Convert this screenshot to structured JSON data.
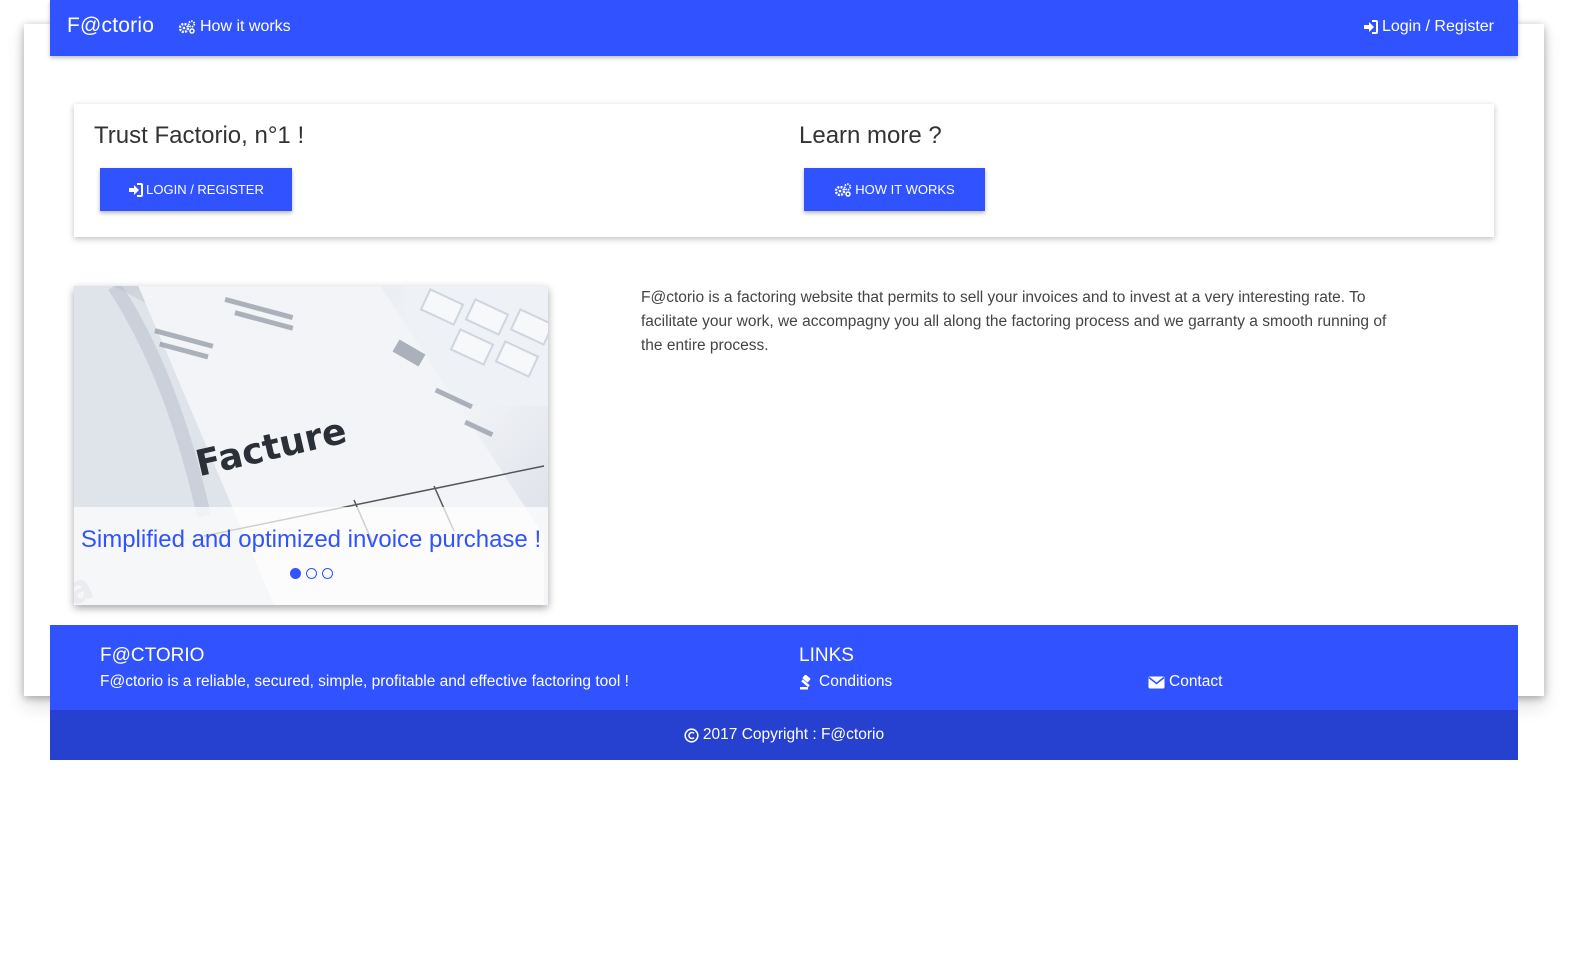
{
  "navbar": {
    "brand": "F@ctorio",
    "how_label": "How it works",
    "login_label": "Login / Register"
  },
  "hero": {
    "left_title": "Trust Factorio, n°1 !",
    "login_button": "LOGIN / REGISTER",
    "right_title": "Learn more ?",
    "how_button": "HOW IT WORKS"
  },
  "carousel": {
    "caption": "Simplified and optimized invoice purchase !",
    "image_word": "Facture",
    "slide_count": 3,
    "active_index": 0
  },
  "description": "F@ctorio is a factoring website that permits to sell your invoices and to invest at a very interesting rate. To facilitate your work, we accompagny you all along the factoring process and we garranty a smooth running of the entire process.",
  "footer": {
    "brand_title": "F@CTORIO",
    "tagline": "F@ctorio is a reliable, secured, simple, profitable and effective factoring tool !",
    "links_title": "LINKS",
    "conditions_label": "Conditions",
    "contact_label": "Contact",
    "copyright": "2017 Copyright : F@ctorio"
  },
  "colors": {
    "primary": "#3153ff",
    "footer_dark": "#2640d0"
  },
  "icons": {
    "how": "gears-icon",
    "login": "sign-in-icon",
    "conditions": "gavel-icon",
    "contact": "envelope-icon",
    "copyright": "copyright-icon"
  }
}
